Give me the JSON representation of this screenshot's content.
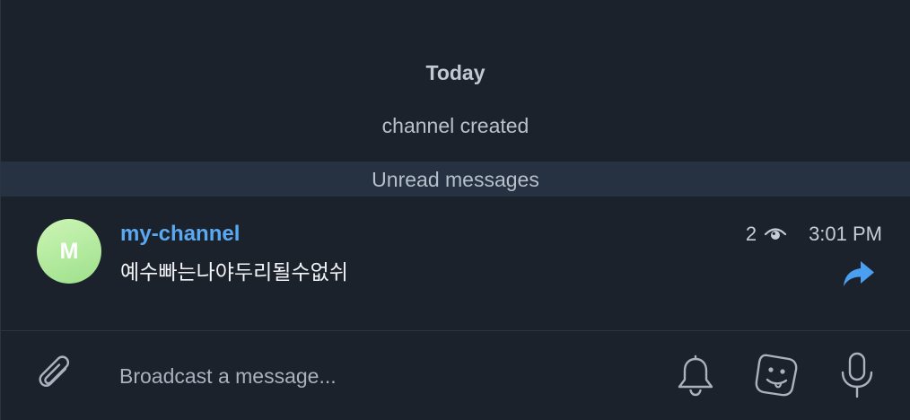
{
  "chat": {
    "date_header": "Today",
    "service_message": "channel created",
    "unread_label": "Unread messages"
  },
  "message": {
    "avatar_initial": "M",
    "author": "my-channel",
    "text": "예수빠는나야두리될수없쉬",
    "views": "2",
    "time": "3:01 PM",
    "avatar_gradient": [
      "#ccf5b5",
      "#9ee08c"
    ],
    "author_color": "#5aa9f0",
    "forward_color": "#4a9ff0"
  },
  "composer": {
    "placeholder": "Broadcast a message..."
  },
  "icons": {
    "views": "eye-icon",
    "forward": "forward-arrow-icon",
    "attach": "paperclip-icon",
    "notifications": "bell-icon",
    "stickers": "sticker-icon",
    "voice": "microphone-icon"
  }
}
